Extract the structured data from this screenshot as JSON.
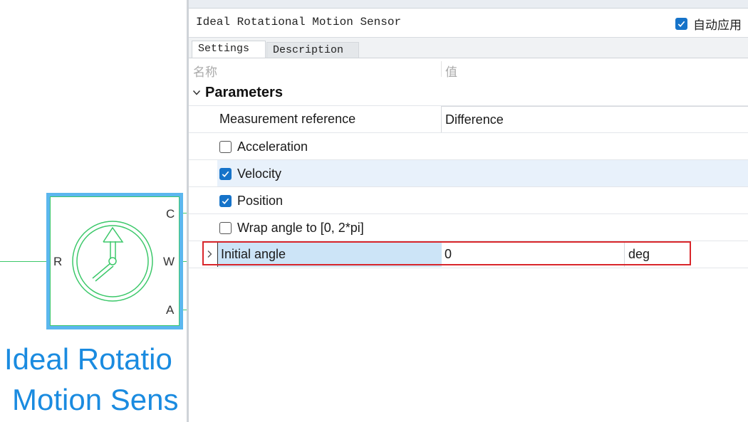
{
  "canvas": {
    "block_caption_line1": "Ideal Rotatio",
    "block_caption_line2": "Motion Sens",
    "ports": {
      "r": "R",
      "c": "C",
      "w": "W",
      "a": "A"
    }
  },
  "panel": {
    "block_name": "Ideal Rotational Motion Sensor",
    "auto_apply_label": "自动应用",
    "auto_apply_checked": true,
    "tabs": [
      {
        "label": "Settings",
        "active": true
      },
      {
        "label": "Description",
        "active": false
      }
    ],
    "columns": {
      "name": "名称",
      "value": "值"
    },
    "group": {
      "label": "Parameters",
      "expanded": true
    },
    "params": {
      "measurement_reference": {
        "label": "Measurement reference",
        "value": "Difference"
      },
      "acceleration": {
        "label": "Acceleration",
        "checked": false
      },
      "velocity": {
        "label": "Velocity",
        "checked": true
      },
      "position": {
        "label": "Position",
        "checked": true
      },
      "wrap_angle": {
        "label": "Wrap angle to [0, 2*pi]",
        "checked": false
      },
      "initial_angle": {
        "label": "Initial angle",
        "value": "0",
        "unit": "deg"
      }
    }
  },
  "colors": {
    "accent": "#1673c9",
    "selection": "#cce4f7",
    "highlight_border": "#d9262b",
    "block_green": "#3cc86a",
    "block_frame_blue": "#5bb7ee",
    "caption_blue": "#1a8be0"
  },
  "icons": {
    "sensor_symbol": "rotational-sensor-icon",
    "checkbox_checked": "checkmark-icon",
    "group_toggle": "chevron-down-icon",
    "row_expand": "chevron-right-icon"
  }
}
